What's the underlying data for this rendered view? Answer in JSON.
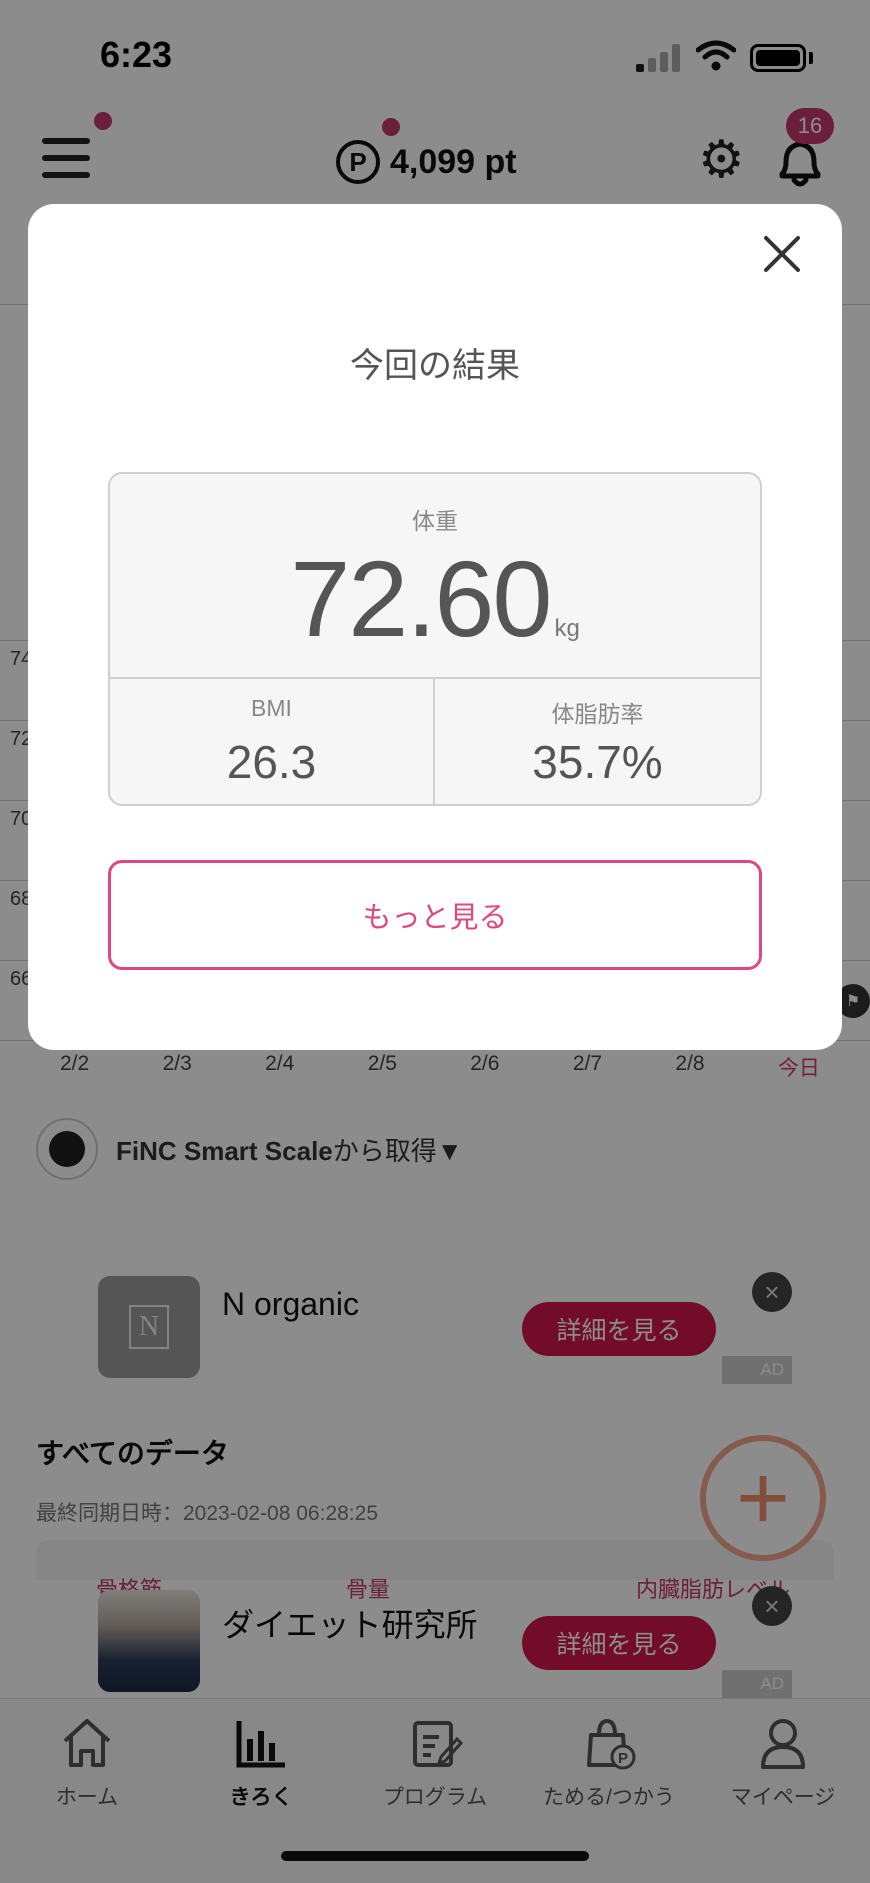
{
  "status_bar": {
    "time": "6:23"
  },
  "header": {
    "points": "4,099 pt",
    "points_icon": "P",
    "notification_count": "16"
  },
  "chart": {
    "y_labels": [
      "74",
      "72",
      "70",
      "68",
      "66"
    ],
    "x_labels": [
      "2/2",
      "2/3",
      "2/4",
      "2/5",
      "2/6",
      "2/7",
      "2/8",
      "今日"
    ]
  },
  "source": {
    "brand": "FiNC Smart Scale",
    "suffix": "から取得▼"
  },
  "ads": [
    {
      "title": "N organic",
      "button": "詳細を見る",
      "label": "AD",
      "thumb_letter": "N"
    },
    {
      "title": "ダイエット研究所",
      "button": "詳細を見る",
      "label": "AD"
    }
  ],
  "all_data": {
    "title": "すべてのデータ",
    "last_sync": "最終同期日時：2023-02-08 06:28:25",
    "metrics": [
      "骨格筋",
      "骨量",
      "内臓脂肪レベル"
    ]
  },
  "modal": {
    "title": "今回の結果",
    "weight_label": "体重",
    "weight_value": "72.60",
    "weight_unit": "kg",
    "bmi_label": "BMI",
    "bmi_value": "26.3",
    "body_fat_label": "体脂肪率",
    "body_fat_value": "35.7%",
    "more_button": "もっと見る"
  },
  "tabs": [
    {
      "label": "ホーム",
      "icon": "home-icon"
    },
    {
      "label": "きろく",
      "icon": "chart-icon",
      "active": true
    },
    {
      "label": "プログラム",
      "icon": "program-icon"
    },
    {
      "label": "ためる/つかう",
      "icon": "point-bag-icon"
    },
    {
      "label": "マイページ",
      "icon": "person-icon"
    }
  ],
  "colors": {
    "accent": "#e0477f",
    "ad_button": "#d2154d",
    "badge": "#c33a6c"
  }
}
